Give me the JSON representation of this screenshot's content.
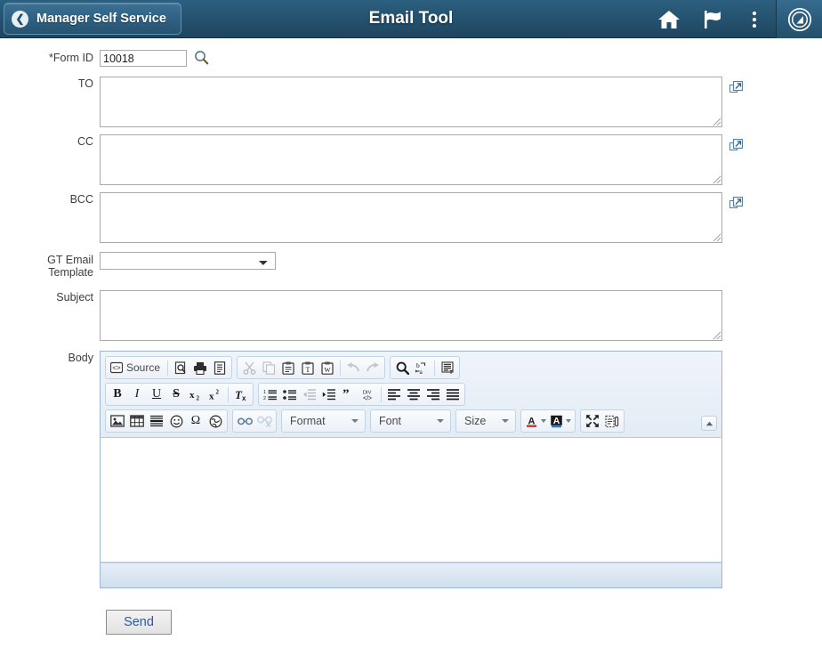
{
  "header": {
    "back_label": "Manager Self Service",
    "title": "Email Tool",
    "icons": [
      {
        "name": "home-icon",
        "label": "Home"
      },
      {
        "name": "flag-icon",
        "label": "Notifications"
      },
      {
        "name": "kebab-menu-icon",
        "label": "Actions"
      },
      {
        "name": "nav-compass-icon",
        "label": "NavBar"
      }
    ]
  },
  "form": {
    "form_id": {
      "label": "*Form ID",
      "value": "10018",
      "lookup_icon": "magnifier-icon"
    },
    "to": {
      "label": "TO",
      "value": "",
      "expand_icon": "open-in-new-window-icon"
    },
    "cc": {
      "label": "CC",
      "value": "",
      "expand_icon": "open-in-new-window-icon"
    },
    "bcc": {
      "label": "BCC",
      "value": "",
      "expand_icon": "open-in-new-window-icon"
    },
    "template": {
      "label": "GT Email Template",
      "value": "",
      "options": [
        ""
      ]
    },
    "subject": {
      "label": "Subject",
      "value": ""
    },
    "body": {
      "label": "Body",
      "value": ""
    },
    "send": {
      "label": "Send"
    }
  },
  "editor": {
    "toolbar_rows": [
      {
        "groups": [
          {
            "items": [
              {
                "name": "source-button",
                "label": "Source",
                "icon": "source-code-icon",
                "disabled": false
              },
              {
                "name": "separator",
                "label": "",
                "icon": "separator",
                "disabled": false
              },
              {
                "name": "preview-button",
                "label": "",
                "icon": "preview-icon",
                "disabled": false
              },
              {
                "name": "print-button",
                "label": "",
                "icon": "print-icon",
                "disabled": false
              },
              {
                "name": "templates-button",
                "label": "",
                "icon": "templates-icon",
                "disabled": false
              }
            ]
          },
          {
            "items": [
              {
                "name": "cut-button",
                "label": "",
                "icon": "scissors-icon",
                "disabled": true
              },
              {
                "name": "copy-button",
                "label": "",
                "icon": "copy-icon",
                "disabled": true
              },
              {
                "name": "paste-button",
                "label": "",
                "icon": "clipboard-icon",
                "disabled": false
              },
              {
                "name": "paste-text-button",
                "label": "",
                "icon": "clipboard-text-icon",
                "disabled": false
              },
              {
                "name": "paste-word-button",
                "label": "",
                "icon": "clipboard-word-icon",
                "disabled": false
              },
              {
                "name": "separator",
                "label": "",
                "icon": "separator",
                "disabled": false
              },
              {
                "name": "undo-button",
                "label": "",
                "icon": "undo-arrow-icon",
                "disabled": true
              },
              {
                "name": "redo-button",
                "label": "",
                "icon": "redo-arrow-icon",
                "disabled": true
              }
            ]
          },
          {
            "items": [
              {
                "name": "find-button",
                "label": "",
                "icon": "magnifier-icon",
                "disabled": false
              },
              {
                "name": "replace-button",
                "label": "",
                "icon": "replace-icon",
                "disabled": false
              },
              {
                "name": "separator",
                "label": "",
                "icon": "separator",
                "disabled": false
              },
              {
                "name": "select-all-button",
                "label": "",
                "icon": "select-all-icon",
                "disabled": false
              }
            ]
          }
        ]
      },
      {
        "groups": [
          {
            "items": [
              {
                "name": "bold-button",
                "label": "B",
                "icon": "bold-icon",
                "disabled": false
              },
              {
                "name": "italic-button",
                "label": "I",
                "icon": "italic-icon",
                "disabled": false
              },
              {
                "name": "underline-button",
                "label": "U",
                "icon": "underline-icon",
                "disabled": false
              },
              {
                "name": "strikethrough-button",
                "label": "S",
                "icon": "strikethrough-icon",
                "disabled": false
              },
              {
                "name": "subscript-button",
                "label": "",
                "icon": "subscript-icon",
                "disabled": false
              },
              {
                "name": "superscript-button",
                "label": "",
                "icon": "superscript-icon",
                "disabled": false
              },
              {
                "name": "separator",
                "label": "",
                "icon": "separator",
                "disabled": false
              },
              {
                "name": "remove-format-button",
                "label": "",
                "icon": "remove-format-icon",
                "disabled": false
              }
            ]
          },
          {
            "items": [
              {
                "name": "numbered-list-button",
                "label": "",
                "icon": "numbered-list-icon",
                "disabled": false
              },
              {
                "name": "bulleted-list-button",
                "label": "",
                "icon": "bulleted-list-icon",
                "disabled": false
              },
              {
                "name": "outdent-button",
                "label": "",
                "icon": "outdent-icon",
                "disabled": true
              },
              {
                "name": "indent-button",
                "label": "",
                "icon": "indent-icon",
                "disabled": false
              },
              {
                "name": "blockquote-button",
                "label": "",
                "icon": "blockquote-icon",
                "disabled": false
              },
              {
                "name": "div-container-button",
                "label": "",
                "icon": "div-container-icon",
                "disabled": false
              },
              {
                "name": "separator",
                "label": "",
                "icon": "separator",
                "disabled": false
              },
              {
                "name": "align-left-button",
                "label": "",
                "icon": "align-left-icon",
                "disabled": false
              },
              {
                "name": "align-center-button",
                "label": "",
                "icon": "align-center-icon",
                "disabled": false
              },
              {
                "name": "align-right-button",
                "label": "",
                "icon": "align-right-icon",
                "disabled": false
              },
              {
                "name": "align-justify-button",
                "label": "",
                "icon": "align-justify-icon",
                "disabled": false
              }
            ]
          }
        ]
      },
      {
        "groups": [
          {
            "items": [
              {
                "name": "insert-image-button",
                "label": "",
                "icon": "image-icon",
                "disabled": false
              },
              {
                "name": "insert-table-button",
                "label": "",
                "icon": "table-icon",
                "disabled": false
              },
              {
                "name": "horizontal-rule-button",
                "label": "",
                "icon": "horizontal-rule-icon",
                "disabled": false
              },
              {
                "name": "smiley-button",
                "label": "",
                "icon": "smiley-icon",
                "disabled": false
              },
              {
                "name": "special-character-button",
                "label": "Ω",
                "icon": "omega-icon",
                "disabled": false
              },
              {
                "name": "page-break-button",
                "label": "",
                "icon": "globe-icon",
                "disabled": false
              }
            ]
          },
          {
            "items": [
              {
                "name": "link-button",
                "label": "",
                "icon": "link-icon",
                "disabled": false
              },
              {
                "name": "unlink-button",
                "label": "",
                "icon": "unlink-icon",
                "disabled": true
              }
            ]
          }
        ],
        "combos": [
          {
            "name": "format-dropdown",
            "label": "Format"
          },
          {
            "name": "font-dropdown",
            "label": "Font"
          },
          {
            "name": "size-dropdown",
            "label": "Size"
          }
        ],
        "color_group": [
          {
            "name": "text-color-button",
            "label": "A",
            "icon": "text-color-icon",
            "disabled": false
          },
          {
            "name": "background-color-button",
            "label": "A",
            "icon": "background-color-icon",
            "disabled": false
          }
        ],
        "tools_group": [
          {
            "name": "maximize-button",
            "label": "",
            "icon": "maximize-icon",
            "disabled": false
          },
          {
            "name": "show-blocks-button",
            "label": "",
            "icon": "show-blocks-icon",
            "disabled": false
          }
        ],
        "collapse": {
          "name": "collapse-toolbar-button",
          "icon": "chevron-up-icon"
        }
      }
    ]
  },
  "colors": {
    "header_bg": "#265571",
    "back_btn_bg": "#2f6184",
    "toolbar_bg": "#e7eef7",
    "editor_border": "#9fb6cd",
    "send_text": "#2c5aa0"
  }
}
